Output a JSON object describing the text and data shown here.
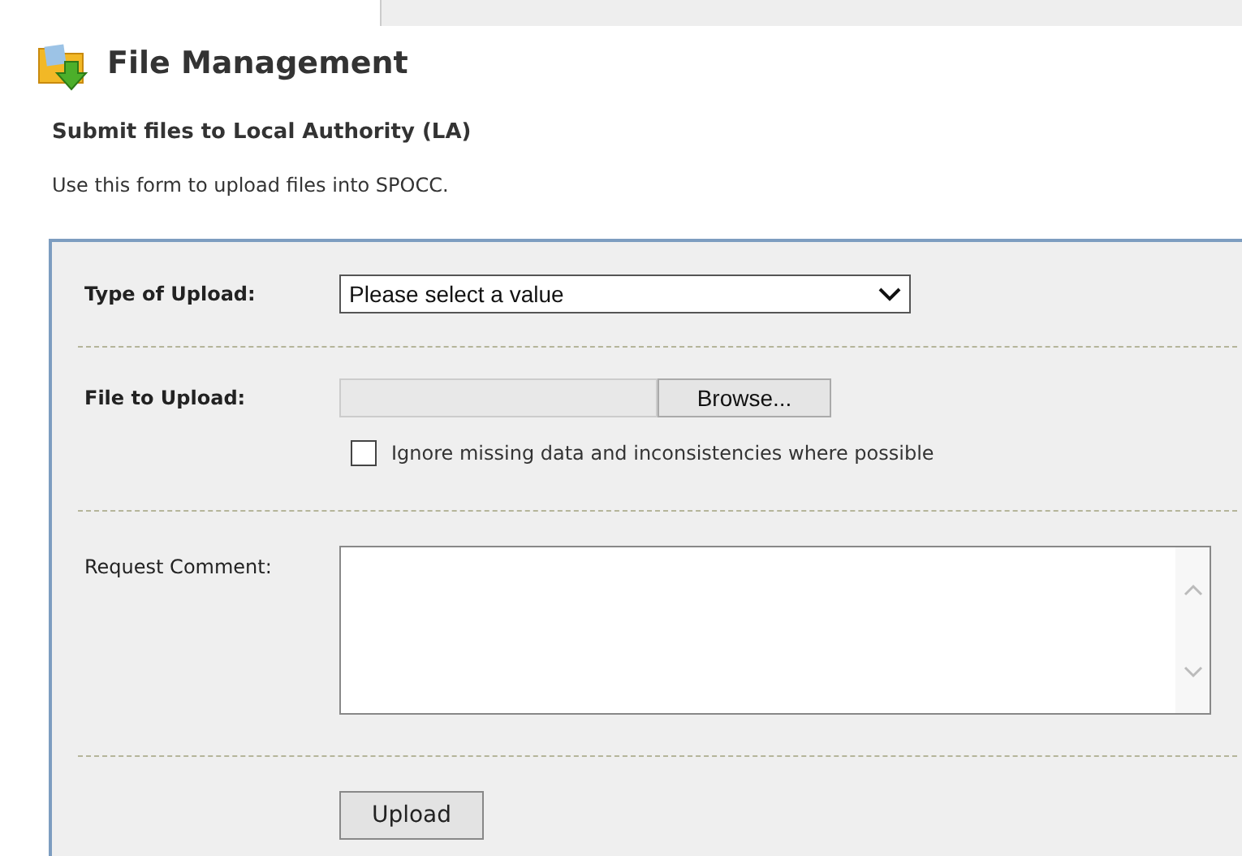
{
  "page_title": "File Management",
  "section_title": "Submit files to Local Authority (LA)",
  "description": "Use this form to upload files into SPOCC.",
  "form": {
    "type_label": "Type of Upload:",
    "type_value": "Please select a value",
    "file_label": "File to Upload:",
    "browse_button": "Browse...",
    "ignore_checkbox": {
      "label": "Ignore missing data and inconsistencies where possible",
      "checked": false
    },
    "comment_label": "Request Comment:",
    "upload_button": "Upload"
  }
}
